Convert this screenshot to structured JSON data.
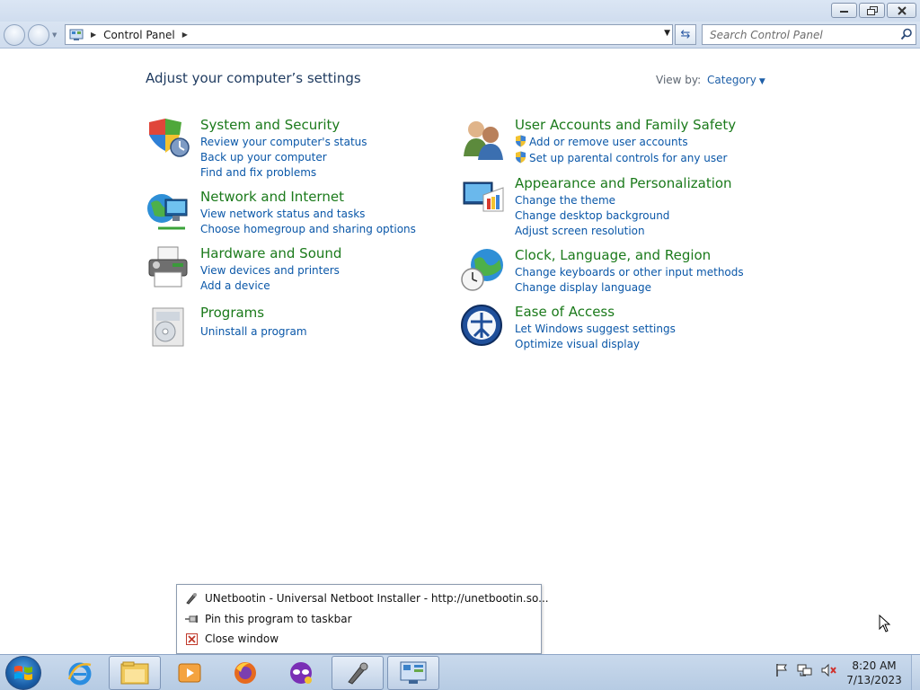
{
  "window": {
    "title_buttons": [
      "minimize-icon",
      "restore-icon",
      "close-icon"
    ]
  },
  "navbar": {
    "breadcrumb": "Control Panel",
    "search_placeholder": "Search Control Panel"
  },
  "content": {
    "title": "Adjust your computer’s settings",
    "view_by_label": "View by:",
    "view_by_value": "Category",
    "categories": [
      {
        "title": "System and Security",
        "icon": "shield-icon",
        "links": [
          "Review your computer's status",
          "Back up your computer",
          "Find and fix problems"
        ]
      },
      {
        "title": "Network and Internet",
        "icon": "network-globe-icon",
        "links": [
          "View network status and tasks",
          "Choose homegroup and sharing options"
        ]
      },
      {
        "title": "Hardware and Sound",
        "icon": "printer-icon",
        "links": [
          "View devices and printers",
          "Add a device"
        ]
      },
      {
        "title": "Programs",
        "icon": "programs-icon",
        "links": [
          "Uninstall a program"
        ]
      },
      {
        "title": "User Accounts and Family Safety",
        "icon": "users-icon",
        "links": [
          "Add or remove user accounts",
          "Set up parental controls for any user"
        ]
      },
      {
        "title": "Appearance and Personalization",
        "icon": "monitor-palette-icon",
        "links": [
          "Change the theme",
          "Change desktop background",
          "Adjust screen resolution"
        ]
      },
      {
        "title": "Clock, Language, and Region",
        "icon": "clock-globe-icon",
        "links": [
          "Change keyboards or other input methods",
          "Change display language"
        ]
      },
      {
        "title": "Ease of Access",
        "icon": "ease-of-access-icon",
        "links": [
          "Let Windows suggest settings",
          "Optimize visual display"
        ]
      }
    ]
  },
  "jumplist": {
    "items": [
      {
        "label": "UNetbootin - Universal Netboot Installer - http://unetbootin.so...",
        "icon": "unetbootin-icon"
      },
      {
        "label": "Pin this program to taskbar",
        "icon": "pin-icon"
      },
      {
        "label": "Close window",
        "icon": "close-window-icon"
      }
    ]
  },
  "taskbar": {
    "apps": [
      "internet-explorer-icon",
      "file-explorer-icon",
      "media-player-icon",
      "firefox-icon",
      "maskot-icon",
      "unetbootin-icon",
      "control-panel-icon"
    ],
    "clock_time": "8:20 AM",
    "clock_date": "7/13/2023"
  },
  "colors": {
    "category_title": "#1b7a1b",
    "link": "#0a57a8",
    "page_title": "#1e3a5f",
    "taskbar": "#b6cbe3"
  }
}
